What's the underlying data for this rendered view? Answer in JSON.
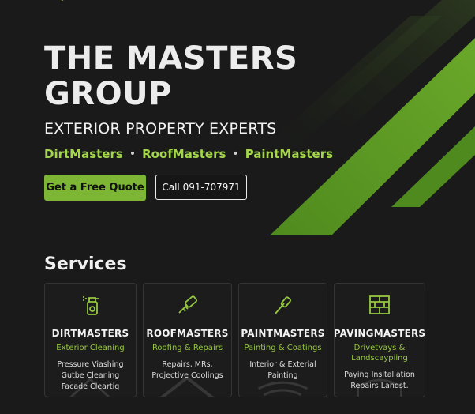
{
  "hero": {
    "title_line1": "THE MASTERS",
    "title_line2": "GROUP",
    "subtitle": "EXTERIOR PROPERTY EXPERTS",
    "brands": [
      "DirtMasters",
      "RoofMasters",
      "PaintMasters"
    ],
    "separator": "•",
    "primary_button": "Get a Free Quote",
    "secondary_button": "Call 091-707971"
  },
  "services": {
    "heading": "Services",
    "cards": [
      {
        "name": "DIRTMASTERS",
        "category": "Exterior Cleaning",
        "lines": [
          "Pressure Viashing",
          "Gutbe Cleaning",
          "Facade Cleartig"
        ],
        "icon": "spray-bottle-icon"
      },
      {
        "name": "ROOFMASTERS",
        "category": "Roofing & Repairs",
        "lines": [
          "Repairs, MRs,",
          "Projective Coolings"
        ],
        "icon": "roller-brush-icon"
      },
      {
        "name": "PAINTMASTERS",
        "category": "Painting & Coatings",
        "lines": [
          "Interior & Exterial",
          "Painting"
        ],
        "icon": "paintbrush-icon"
      },
      {
        "name": "PAVINGMASTERS",
        "category_lines": [
          "Drivetvays &",
          "Landscaypiing"
        ],
        "lines": [
          "Paying Insitallation",
          "Repairs Landst."
        ],
        "icon": "bricks-icon"
      }
    ]
  },
  "colors": {
    "accent": "#7db534",
    "accent_text": "#a3d64a",
    "background": "#1a1a1a"
  }
}
